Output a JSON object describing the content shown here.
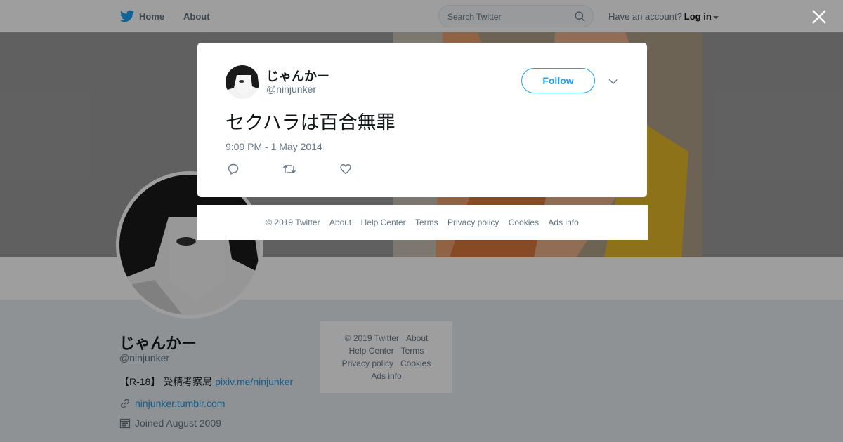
{
  "nav": {
    "home_label": "Home",
    "about_label": "About",
    "search_placeholder": "Search Twitter",
    "account_prompt": "Have an account?",
    "login_label": "Log in"
  },
  "profile": {
    "name": "じゃんかー",
    "handle": "@ninjunker",
    "bio_text": "【R-18】 受精考察局 ",
    "bio_link": "pixiv.me/ninjunker",
    "website": "ninjunker.tumblr.com",
    "joined": "Joined August 2009"
  },
  "side_footer": {
    "line1": [
      "© 2019 Twitter",
      "About"
    ],
    "line2": [
      "Help Center",
      "Terms"
    ],
    "line3": [
      "Privacy policy",
      "Cookies"
    ],
    "line4": [
      "Ads info"
    ]
  },
  "tweet": {
    "author_name": "じゃんかー",
    "author_handle": "@ninjunker",
    "follow_label": "Follow",
    "text": "セクハラは百合無罪",
    "timestamp": "9:09 PM - 1 May 2014"
  },
  "modal_footer": {
    "items": [
      "© 2019 Twitter",
      "About",
      "Help Center",
      "Terms",
      "Privacy policy",
      "Cookies",
      "Ads info"
    ]
  },
  "colors": {
    "accent": "#1da1f2",
    "link": "#1b95e0",
    "muted": "#657786"
  }
}
